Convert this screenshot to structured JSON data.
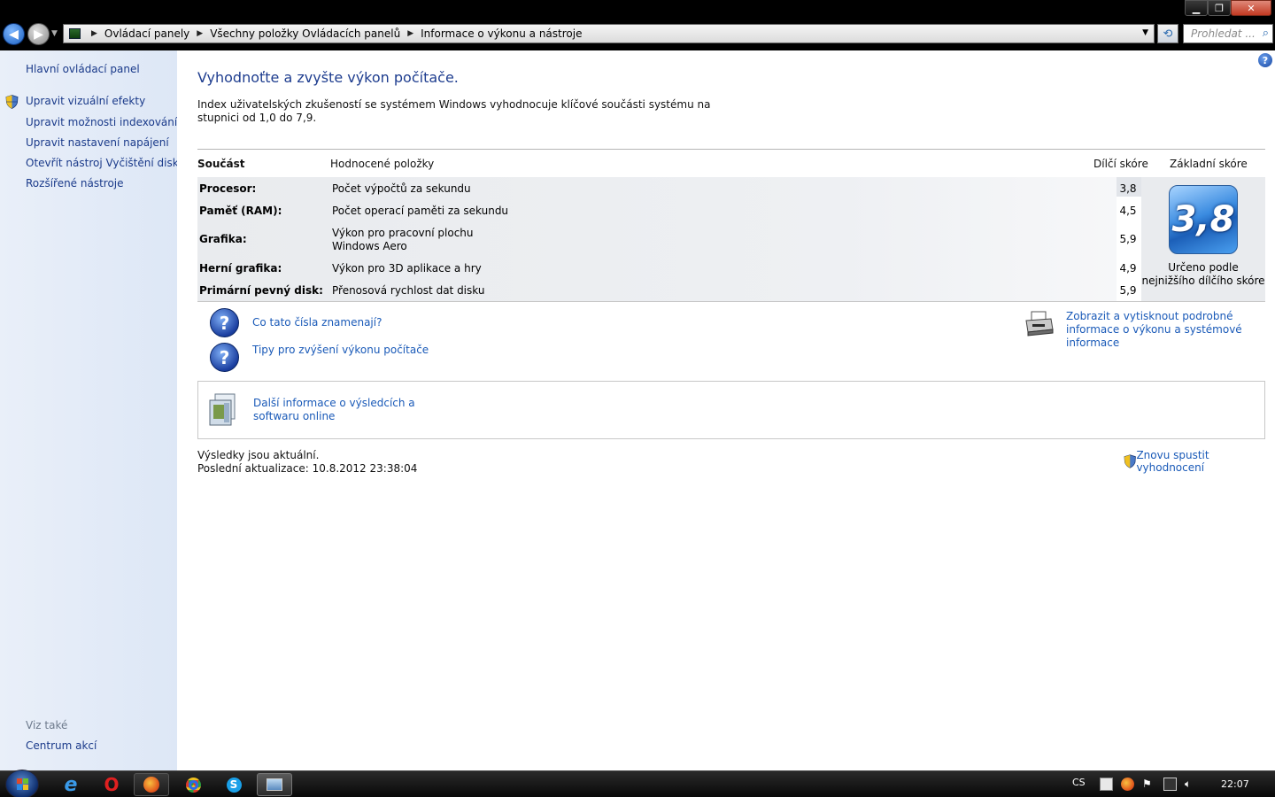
{
  "window": {
    "minimize_glyph": "▁",
    "maximize_glyph": "❐",
    "close_glyph": "✕"
  },
  "nav": {
    "back_glyph": "◀",
    "forward_glyph": "▶",
    "dropdown_glyph": "▼"
  },
  "address": {
    "crumbs": [
      "Ovládací panely",
      "Všechny položky Ovládacích panelů",
      "Informace o výkonu a nástroje"
    ],
    "separator": "▶",
    "dropdown_glyph": "▼",
    "refresh_glyph": "⟲"
  },
  "search": {
    "placeholder": "Prohledat ...",
    "icon": "search-icon"
  },
  "sidebar": {
    "home": "Hlavní ovládací panel",
    "items": [
      "Upravit vizuální efekty",
      "Upravit možnosti indexování",
      "Upravit nastavení napájení",
      "Otevřít nástroj Vyčištění disku",
      "Rozšířené nástroje"
    ],
    "see_also_title": "Viz také",
    "see_also": [
      "Centrum akcí"
    ]
  },
  "main": {
    "help_glyph": "?",
    "title": "Vyhodnoťte a zvyšte výkon počítače.",
    "intro": "Index uživatelských zkušeností se systémem Windows vyhodnocuje klíčové součásti systému na stupnici od 1,0 do 7,9.",
    "table": {
      "headers": [
        "Součást",
        "Hodnocené položky",
        "Dílčí skóre",
        "Základní skóre"
      ],
      "rows": [
        {
          "component": "Procesor:",
          "item": "Počet výpočtů za sekundu",
          "score": "3,8"
        },
        {
          "component": "Paměť (RAM):",
          "item": "Počet operací paměti za sekundu",
          "score": "4,5"
        },
        {
          "component": "Grafika:",
          "item": "Výkon pro pracovní plochu Windows Aero",
          "score": "5,9"
        },
        {
          "component": "Herní grafika:",
          "item": "Výkon pro 3D aplikace a hry",
          "score": "4,9"
        },
        {
          "component": "Primární pevný disk:",
          "item": "Přenosová rychlost dat disku",
          "score": "5,9"
        }
      ],
      "base_score": "3,8",
      "base_caption": "Určeno podle nejnižšího dílčího skóre"
    },
    "links": {
      "what_mean": "Co tato čísla znamenají?",
      "tips": "Tipy pro zvýšení výkonu počítače",
      "print": "Zobrazit a vytisknout podrobné informace o výkonu a systémové informace",
      "more_info": "Další informace o výsledcích a softwaru online"
    },
    "question_glyph": "?",
    "status": {
      "current": "Výsledky jsou aktuální.",
      "last_update": "Poslední aktualizace: 10.8.2012 23:38:04"
    },
    "rerun": "Znovu spustit vyhodnocení"
  },
  "taskbar": {
    "language": "CS",
    "clock": "22:07",
    "ie_glyph": "e",
    "opera_glyph": "O"
  }
}
